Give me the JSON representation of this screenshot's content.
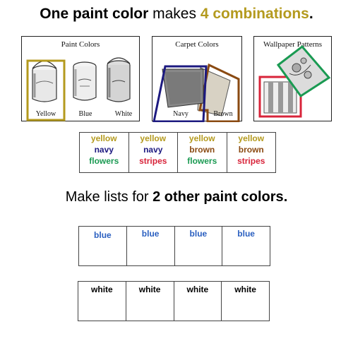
{
  "headline": {
    "part1": "One paint color",
    "part2": " makes ",
    "part3": "4 combinations",
    "part4": "."
  },
  "panels": {
    "paint": {
      "title": "Paint Colors",
      "labels": [
        "Yellow",
        "Blue",
        "White"
      ]
    },
    "carpet": {
      "title": "Carpet Colors",
      "labels": [
        "Navy",
        "Brown"
      ]
    },
    "wallpaper": {
      "title": "Wallpaper Patterns"
    }
  },
  "combinations": [
    [
      "yellow",
      "navy",
      "flowers"
    ],
    [
      "yellow",
      "navy",
      "stripes"
    ],
    [
      "yellow",
      "brown",
      "flowers"
    ],
    [
      "yellow",
      "brown",
      "stripes"
    ]
  ],
  "subheading": {
    "part1": "Make lists for ",
    "part2": "2 other paint colors",
    "part3": "."
  },
  "blue_row": [
    "blue",
    "blue",
    "blue",
    "blue"
  ],
  "white_row": [
    "white",
    "white",
    "white",
    "white"
  ],
  "colors": {
    "gold": "#b49a1e",
    "navy": "#1d1a80",
    "brown": "#8a4a12",
    "green": "#1a9a52",
    "red": "#d8243a",
    "blue": "#2a5fc0"
  }
}
